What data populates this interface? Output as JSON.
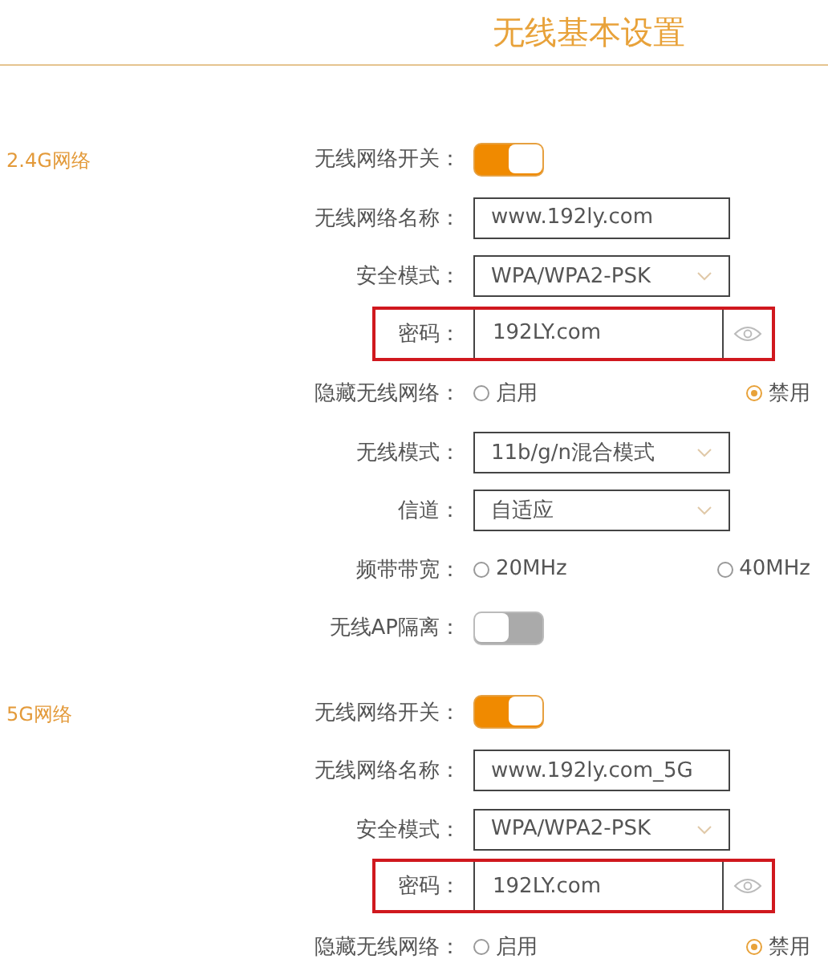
{
  "title": "无线基本设置",
  "sections": [
    {
      "label": "2.4G网络",
      "rows": [
        {
          "kind": "toggle",
          "label": "无线网络开关：",
          "on": true
        },
        {
          "kind": "text",
          "label": "无线网络名称：",
          "value": "www.192ly.com"
        },
        {
          "kind": "select",
          "label": "安全模式：",
          "value": "WPA/WPA2-PSK"
        },
        {
          "kind": "password",
          "label": "密码：",
          "value": "192LY.com",
          "highlighted": true
        },
        {
          "kind": "radio",
          "label": "隐藏无线网络：",
          "options": [
            {
              "label": "启用",
              "selected": false
            },
            {
              "label": "禁用",
              "selected": true
            }
          ]
        },
        {
          "kind": "select",
          "label": "无线模式：",
          "value": "11b/g/n混合模式"
        },
        {
          "kind": "select",
          "label": "信道：",
          "value": "自适应"
        },
        {
          "kind": "radio",
          "label": "频带带宽：",
          "options": [
            {
              "label": "20MHz",
              "selected": false
            },
            {
              "label": "40MHz",
              "selected": false
            }
          ]
        },
        {
          "kind": "toggle",
          "label": "无线AP隔离：",
          "on": false
        }
      ]
    },
    {
      "label": "5G网络",
      "rows": [
        {
          "kind": "toggle",
          "label": "无线网络开关：",
          "on": true
        },
        {
          "kind": "text",
          "label": "无线网络名称：",
          "value": "www.192ly.com_5G"
        },
        {
          "kind": "select",
          "label": "安全模式：",
          "value": "WPA/WPA2-PSK"
        },
        {
          "kind": "password",
          "label": "密码：",
          "value": "192LY.com",
          "highlighted": true
        },
        {
          "kind": "radio",
          "label": "隐藏无线网络：",
          "options": [
            {
              "label": "启用",
              "selected": false
            },
            {
              "label": "禁用",
              "selected": true
            }
          ]
        }
      ]
    }
  ]
}
